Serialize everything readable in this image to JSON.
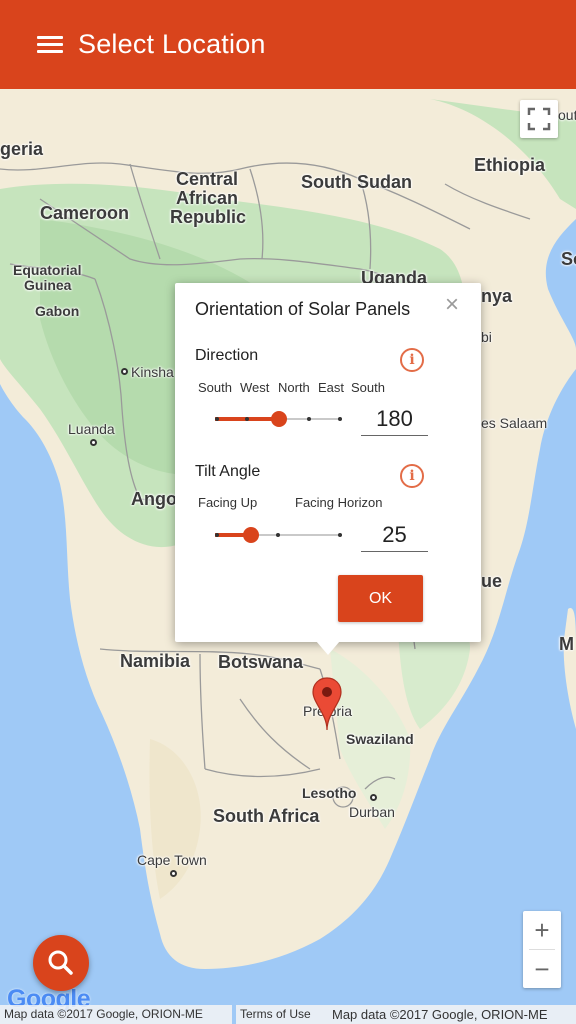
{
  "app_bar": {
    "title": "Select Location",
    "background": "#d9441c"
  },
  "map": {
    "water_color": "#9fc9f6",
    "labels": {
      "nigeria": "geria",
      "cameroon": "Cameroon",
      "car": "Central African Republic",
      "car_line1": "Central",
      "car_line2": "African",
      "car_line3": "Republic",
      "south_sudan": "South Sudan",
      "ethiopia": "Ethiopia",
      "equatorial_guinea_1": "Equatorial",
      "equatorial_guinea_2": "Guinea",
      "gabon": "Gabon",
      "uganda": "Uganda",
      "kenya": "nya",
      "nairobi": "bi",
      "kinshasa": "Kinsha",
      "luanda": "Luanda",
      "angola": "Ango",
      "dar_es_salaam": "es Salaam",
      "mozambique": "ue",
      "madagascar": "M",
      "namibia": "Namibia",
      "botswana": "Botswana",
      "pretoria": "Pretoria",
      "swaziland": "Swaziland",
      "lesotho": "Lesotho",
      "durban": "Durban",
      "south_africa": "South Africa",
      "cape_town": "Cape Town",
      "somalia_edge": "So",
      "edge_top_right": "out"
    },
    "icons": {
      "fullscreen": "fullscreen-icon",
      "zoom_in": "+",
      "zoom_out": "−",
      "marker": "map-marker-icon",
      "search": "search-icon"
    },
    "attribution_left": "Map data ©2017 Google, ORION-ME",
    "terms": "Terms of Use",
    "attribution_right": "Map data ©2017 Google, ORION-ME",
    "google_logo": "Google"
  },
  "dialog": {
    "title": "Orientation of Solar Panels",
    "close_symbol": "×",
    "direction": {
      "label": "Direction",
      "info_symbol": "i",
      "ticks": [
        "South",
        "West",
        "North",
        "East",
        "South"
      ],
      "value": "180",
      "slider_fraction": 0.5
    },
    "tilt": {
      "label": "Tilt Angle",
      "info_symbol": "i",
      "tick_start": "Facing Up",
      "tick_end": "Facing Horizon",
      "value": "25",
      "slider_fraction": 0.28
    },
    "ok_label": "OK"
  },
  "accent_color": "#d9441c"
}
